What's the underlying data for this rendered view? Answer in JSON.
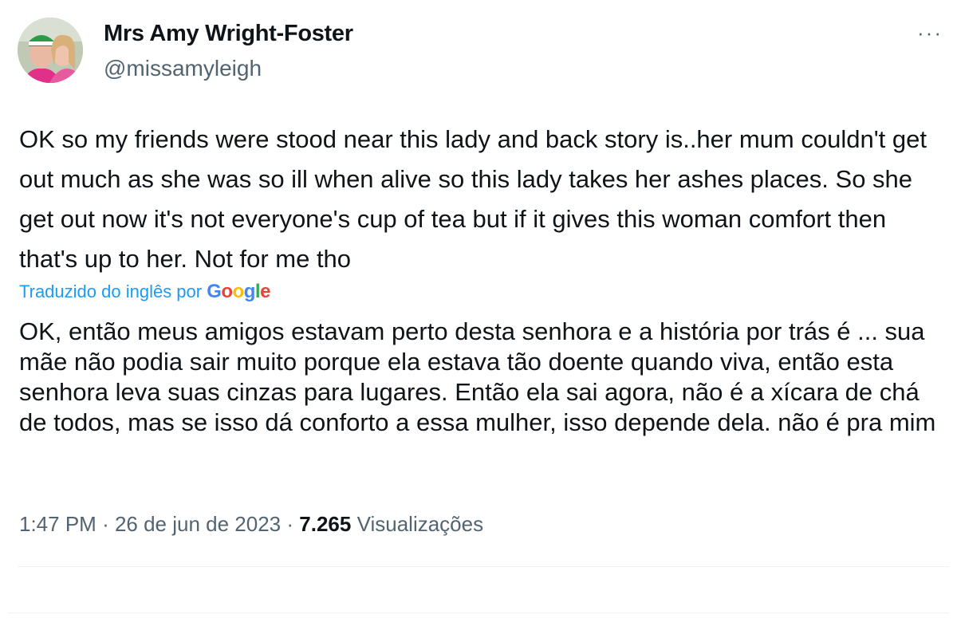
{
  "author": {
    "display_name": "Mrs Amy Wright-Foster",
    "handle": "@missamyleigh"
  },
  "more_icon": "more-horizontal-icon",
  "tweet": {
    "text": "OK so my friends were stood near this lady and back story is..her mum couldn't get out much as she was so ill when alive so this lady takes her ashes places. So she get out now it's not everyone's cup of tea but if it gives this woman comfort then that's up to her. Not for me tho",
    "translation_label": "Traduzido do inglês por",
    "translation_provider": "Google",
    "translation": "OK, então meus amigos estavam perto desta senhora e a história por trás é ... sua mãe não podia sair muito porque ela estava tão doente quando viva, então esta senhora leva suas cinzas para lugares. Então ela sai agora, não é a xícara de chá de todos, mas se isso dá conforto a essa mulher, isso depende dela. não é pra mim"
  },
  "meta": {
    "time": "1:47 PM",
    "date": "26 de jun de 2023",
    "views_count": "7.265",
    "views_label": "Visualizações"
  },
  "colors": {
    "text": "#0f1419",
    "secondary": "#536471",
    "link": "#1d9bf0",
    "divider": "#eff3f4"
  }
}
